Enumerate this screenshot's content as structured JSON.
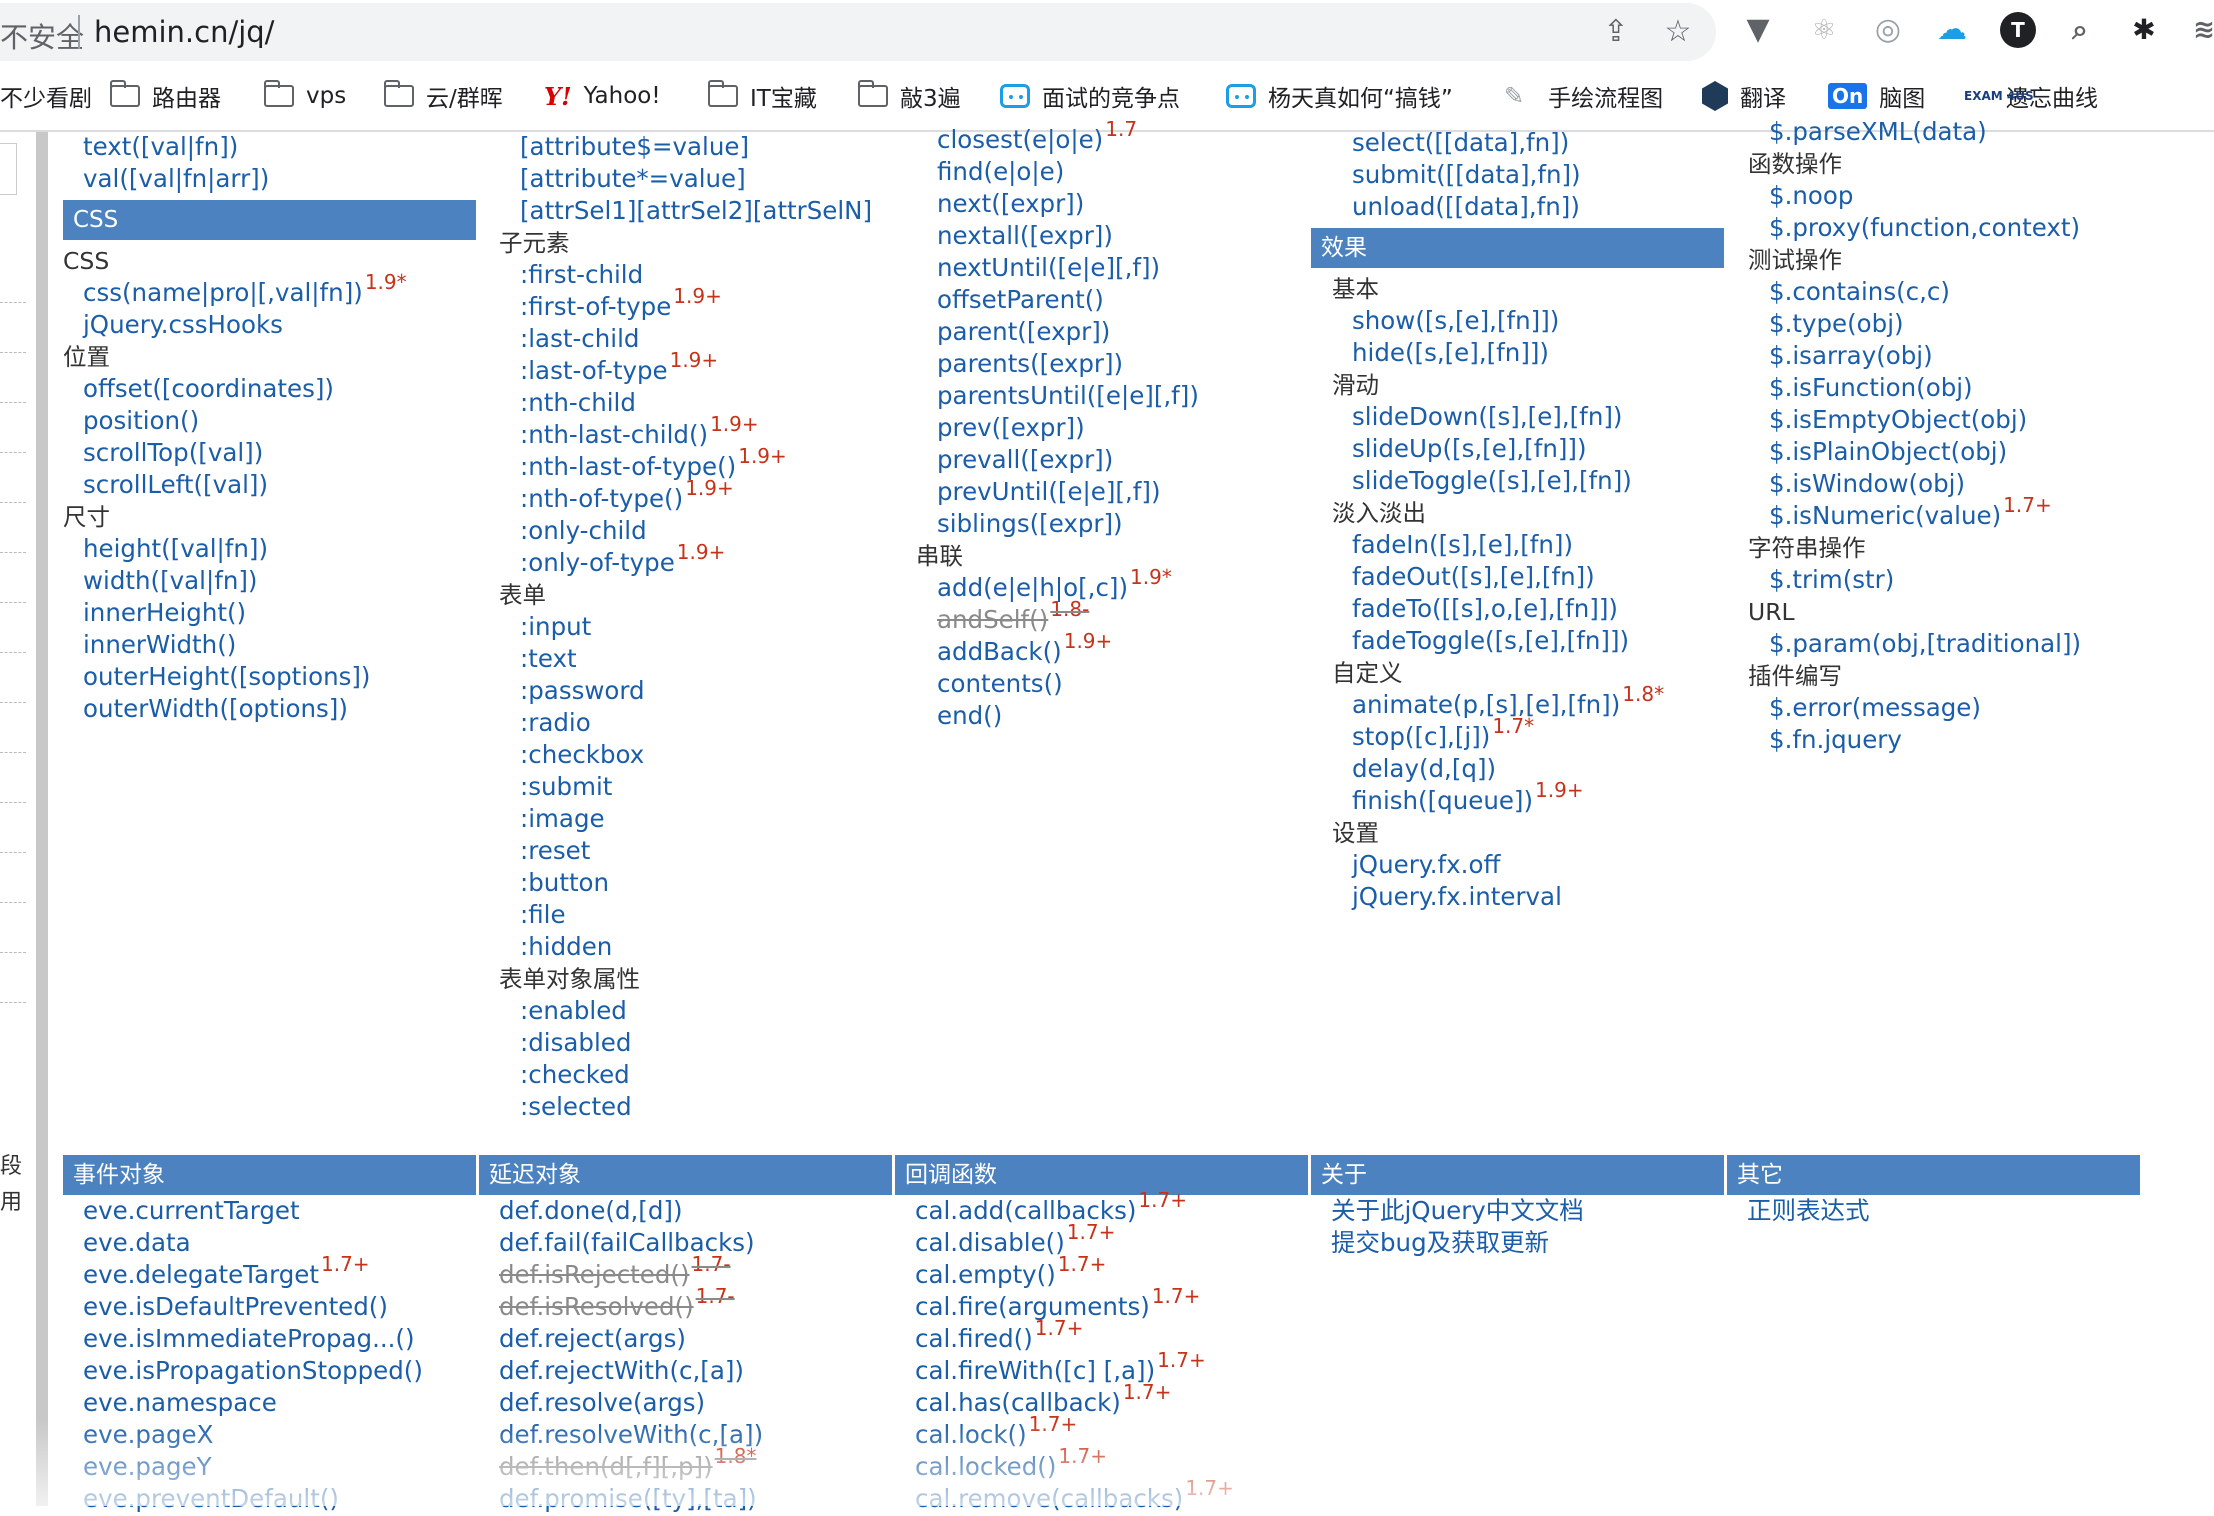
{
  "browser": {
    "security_text": "不安全",
    "url": "hemin.cn/jq/",
    "bookmarks": [
      {
        "label": "不少看剧",
        "icon": "none"
      },
      {
        "label": "路由器",
        "icon": "folder-icon"
      },
      {
        "label": "vps",
        "icon": "folder-icon"
      },
      {
        "label": "云/群晖",
        "icon": "folder-icon"
      },
      {
        "label": "Yahoo!",
        "icon": "yahoo-icon"
      },
      {
        "label": "IT宝藏",
        "icon": "folder-icon"
      },
      {
        "label": "敲3遍",
        "icon": "folder-icon"
      },
      {
        "label": "面试的竞争点",
        "icon": "bilibili-icon"
      },
      {
        "label": "杨天真如何“搞钱”",
        "icon": "bilibili-icon"
      },
      {
        "label": "手绘流程图",
        "icon": "pen-icon"
      },
      {
        "label": "翻译",
        "icon": "fanyi-icon"
      },
      {
        "label": "脑图",
        "icon": "on-icon"
      },
      {
        "label": "遗忘曲线",
        "icon": "exam-icon"
      }
    ],
    "icon_text": {
      "yahoo": "Y!",
      "on": "On",
      "exam": "EXAM 4US"
    }
  },
  "gutter": {
    "chars": [
      "段",
      "用"
    ]
  },
  "columns_top": [
    [
      {
        "t": "item",
        "text": "text([val|fn])"
      },
      {
        "t": "item",
        "text": "val([val|fn|arr])"
      },
      {
        "t": "header",
        "text": "CSS"
      },
      {
        "t": "cat",
        "text": "CSS"
      },
      {
        "t": "item",
        "text": "css(name|pro|[,val|fn])",
        "ver": "1.9*"
      },
      {
        "t": "item",
        "text": "jQuery.cssHooks"
      },
      {
        "t": "cat",
        "text": "位置"
      },
      {
        "t": "item",
        "text": "offset([coordinates])"
      },
      {
        "t": "item",
        "text": "position()"
      },
      {
        "t": "item",
        "text": "scrollTop([val])"
      },
      {
        "t": "item",
        "text": "scrollLeft([val])"
      },
      {
        "t": "cat",
        "text": "尺寸"
      },
      {
        "t": "item",
        "text": "height([val|fn])"
      },
      {
        "t": "item",
        "text": "width([val|fn])"
      },
      {
        "t": "item",
        "text": "innerHeight()"
      },
      {
        "t": "item",
        "text": "innerWidth()"
      },
      {
        "t": "item",
        "text": "outerHeight([soptions])"
      },
      {
        "t": "item",
        "text": "outerWidth([options])"
      }
    ],
    [
      {
        "t": "item",
        "text": "[attribute$=value]"
      },
      {
        "t": "item",
        "text": "[attribute*=value]"
      },
      {
        "t": "item",
        "text": "[attrSel1][attrSel2][attrSelN]"
      },
      {
        "t": "cat",
        "text": "子元素"
      },
      {
        "t": "item",
        "text": ":first-child"
      },
      {
        "t": "item",
        "text": ":first-of-type",
        "ver": "1.9+"
      },
      {
        "t": "item",
        "text": ":last-child"
      },
      {
        "t": "item",
        "text": ":last-of-type",
        "ver": "1.9+"
      },
      {
        "t": "item",
        "text": ":nth-child"
      },
      {
        "t": "item",
        "text": ":nth-last-child()",
        "ver": "1.9+"
      },
      {
        "t": "item",
        "text": ":nth-last-of-type()",
        "ver": "1.9+"
      },
      {
        "t": "item",
        "text": ":nth-of-type()",
        "ver": "1.9+"
      },
      {
        "t": "item",
        "text": ":only-child"
      },
      {
        "t": "item",
        "text": ":only-of-type",
        "ver": "1.9+"
      },
      {
        "t": "cat",
        "text": "表单"
      },
      {
        "t": "item",
        "text": ":input"
      },
      {
        "t": "item",
        "text": ":text"
      },
      {
        "t": "item",
        "text": ":password"
      },
      {
        "t": "item",
        "text": ":radio"
      },
      {
        "t": "item",
        "text": ":checkbox"
      },
      {
        "t": "item",
        "text": ":submit"
      },
      {
        "t": "item",
        "text": ":image"
      },
      {
        "t": "item",
        "text": ":reset"
      },
      {
        "t": "item",
        "text": ":button"
      },
      {
        "t": "item",
        "text": ":file"
      },
      {
        "t": "item",
        "text": ":hidden"
      },
      {
        "t": "cat",
        "text": "表单对象属性"
      },
      {
        "t": "item",
        "text": ":enabled"
      },
      {
        "t": "item",
        "text": ":disabled"
      },
      {
        "t": "item",
        "text": ":checked"
      },
      {
        "t": "item",
        "text": ":selected"
      }
    ],
    [
      {
        "t": "item",
        "text": "closest(e|o|e)",
        "ver": "1.7"
      },
      {
        "t": "item",
        "text": "find(e|o|e)"
      },
      {
        "t": "item",
        "text": "next([expr])"
      },
      {
        "t": "item",
        "text": "nextall([expr])"
      },
      {
        "t": "item",
        "text": "nextUntil([e|e][,f])"
      },
      {
        "t": "item",
        "text": "offsetParent()"
      },
      {
        "t": "item",
        "text": "parent([expr])"
      },
      {
        "t": "item",
        "text": "parents([expr])"
      },
      {
        "t": "item",
        "text": "parentsUntil([e|e][,f])"
      },
      {
        "t": "item",
        "text": "prev([expr])"
      },
      {
        "t": "item",
        "text": "prevall([expr])"
      },
      {
        "t": "item",
        "text": "prevUntil([e|e][,f])"
      },
      {
        "t": "item",
        "text": "siblings([expr])"
      },
      {
        "t": "cat",
        "text": "串联"
      },
      {
        "t": "item",
        "text": "add(e|e|h|o[,c])",
        "ver": "1.9*"
      },
      {
        "t": "item",
        "text": "andSelf()",
        "ver": "1.8-",
        "struck": true
      },
      {
        "t": "item",
        "text": "addBack()",
        "ver": "1.9+"
      },
      {
        "t": "item",
        "text": "contents()"
      },
      {
        "t": "item",
        "text": "end()"
      }
    ],
    [
      {
        "t": "item",
        "text": "select([[data],fn])"
      },
      {
        "t": "item",
        "text": "submit([[data],fn])"
      },
      {
        "t": "item",
        "text": "unload([[data],fn])"
      },
      {
        "t": "header",
        "text": "效果"
      },
      {
        "t": "cat",
        "text": "基本"
      },
      {
        "t": "item",
        "text": "show([s,[e],[fn]])"
      },
      {
        "t": "item",
        "text": "hide([s,[e],[fn]])"
      },
      {
        "t": "cat",
        "text": "滑动"
      },
      {
        "t": "item",
        "text": "slideDown([s],[e],[fn])"
      },
      {
        "t": "item",
        "text": "slideUp([s,[e],[fn]])"
      },
      {
        "t": "item",
        "text": "slideToggle([s],[e],[fn])"
      },
      {
        "t": "cat",
        "text": "淡入淡出"
      },
      {
        "t": "item",
        "text": "fadeIn([s],[e],[fn])"
      },
      {
        "t": "item",
        "text": "fadeOut([s],[e],[fn])"
      },
      {
        "t": "item",
        "text": "fadeTo([[s],o,[e],[fn]])"
      },
      {
        "t": "item",
        "text": "fadeToggle([s,[e],[fn]])"
      },
      {
        "t": "cat",
        "text": "自定义"
      },
      {
        "t": "item",
        "text": "animate(p,[s],[e],[fn])",
        "ver": "1.8*"
      },
      {
        "t": "item",
        "text": "stop([c],[j])",
        "ver": "1.7*"
      },
      {
        "t": "item",
        "text": "delay(d,[q])"
      },
      {
        "t": "item",
        "text": "finish([queue])",
        "ver": "1.9+"
      },
      {
        "t": "cat",
        "text": "设置"
      },
      {
        "t": "item",
        "text": "jQuery.fx.off"
      },
      {
        "t": "item",
        "text": "jQuery.fx.interval"
      }
    ],
    [
      {
        "t": "item",
        "text": "$.parseXML(data)"
      },
      {
        "t": "cat",
        "text": "函数操作"
      },
      {
        "t": "item",
        "text": "$.noop"
      },
      {
        "t": "item",
        "text": "$.proxy(function,context)"
      },
      {
        "t": "cat",
        "text": "测试操作"
      },
      {
        "t": "item",
        "text": "$.contains(c,c)"
      },
      {
        "t": "item",
        "text": "$.type(obj)"
      },
      {
        "t": "item",
        "text": "$.isarray(obj)"
      },
      {
        "t": "item",
        "text": "$.isFunction(obj)"
      },
      {
        "t": "item",
        "text": "$.isEmptyObject(obj)"
      },
      {
        "t": "item",
        "text": "$.isPlainObject(obj)"
      },
      {
        "t": "item",
        "text": "$.isWindow(obj)"
      },
      {
        "t": "item",
        "text": "$.isNumeric(value)",
        "ver": "1.7+"
      },
      {
        "t": "cat",
        "text": "字符串操作"
      },
      {
        "t": "item",
        "text": "$.trim(str)"
      },
      {
        "t": "cat",
        "text": "URL"
      },
      {
        "t": "item",
        "text": "$.param(obj,[traditional])"
      },
      {
        "t": "cat",
        "text": "插件编写"
      },
      {
        "t": "item",
        "text": "$.error(message)"
      },
      {
        "t": "item",
        "text": "$.fn.jquery"
      }
    ]
  ],
  "columns_bottom": [
    {
      "header": "事件对象",
      "items": [
        {
          "text": "eve.currentTarget"
        },
        {
          "text": "eve.data"
        },
        {
          "text": "eve.delegateTarget",
          "ver": "1.7+"
        },
        {
          "text": "eve.isDefaultPrevented()"
        },
        {
          "text": "eve.isImmediatePropag...()"
        },
        {
          "text": "eve.isPropagationStopped()"
        },
        {
          "text": "eve.namespace"
        },
        {
          "text": "eve.pageX"
        },
        {
          "text": "eve.pageY"
        },
        {
          "text": "eve.preventDefault()"
        }
      ]
    },
    {
      "header": "延迟对象",
      "items": [
        {
          "text": "def.done(d,[d])"
        },
        {
          "text": "def.fail(failCallbacks)"
        },
        {
          "text": "def.isRejected()",
          "ver": "1.7-",
          "struck": true
        },
        {
          "text": "def.isResolved()",
          "ver": "1.7-",
          "struck": true
        },
        {
          "text": "def.reject(args)"
        },
        {
          "text": "def.rejectWith(c,[a])"
        },
        {
          "text": "def.resolve(args)"
        },
        {
          "text": "def.resolveWith(c,[a])"
        },
        {
          "text": "def.then(d[,f][,p])",
          "ver": "1.8*",
          "struck": true
        },
        {
          "text": "def.promise([ty],[ta])"
        }
      ]
    },
    {
      "header": "回调函数",
      "items": [
        {
          "text": "cal.add(callbacks)",
          "ver": "1.7+"
        },
        {
          "text": "cal.disable()",
          "ver": "1.7+"
        },
        {
          "text": "cal.empty()",
          "ver": "1.7+"
        },
        {
          "text": "cal.fire(arguments)",
          "ver": "1.7+"
        },
        {
          "text": "cal.fired()",
          "ver": "1.7+"
        },
        {
          "text": "cal.fireWith([c] [,a])",
          "ver": "1.7+"
        },
        {
          "text": "cal.has(callback)",
          "ver": "1.7+"
        },
        {
          "text": "cal.lock()",
          "ver": "1.7+"
        },
        {
          "text": "cal.locked()",
          "ver": "1.7+"
        },
        {
          "text": "cal.remove(callbacks)",
          "ver": "1.7+"
        }
      ]
    },
    {
      "header": "关于",
      "items": [
        {
          "text": "关于此jQuery中文文档"
        },
        {
          "text": "提交bug及获取更新"
        }
      ]
    },
    {
      "header": "其它",
      "items": [
        {
          "text": "正则表达式"
        }
      ]
    }
  ]
}
